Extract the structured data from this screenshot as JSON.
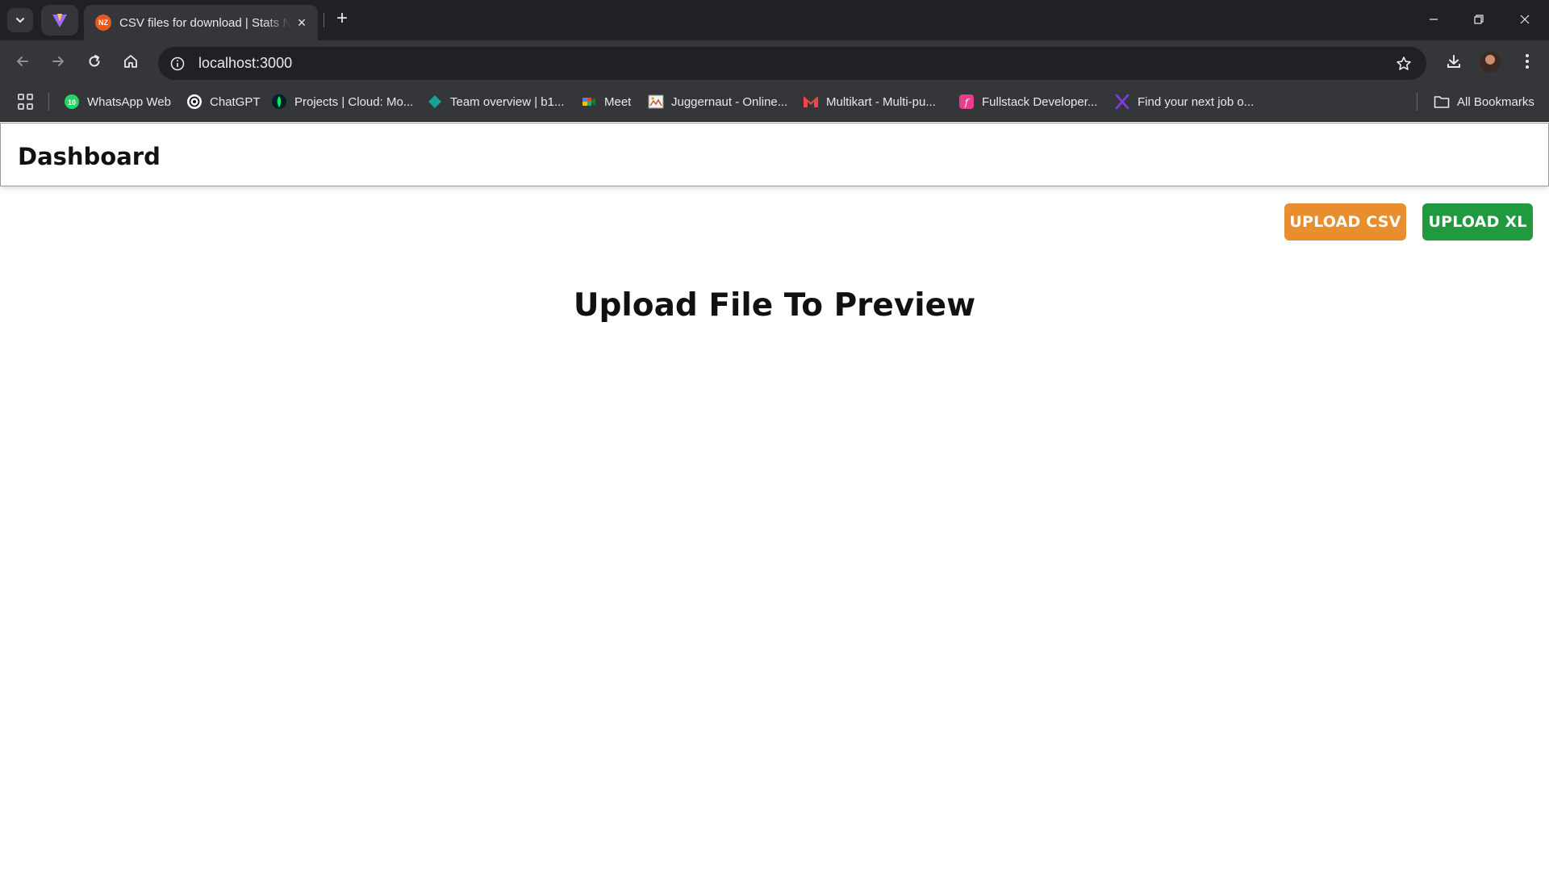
{
  "browser": {
    "active_tab_title": "CSV files for download | Stats NZ",
    "favicon_text": "NZ",
    "address": "localhost:3000",
    "bookmarks": [
      {
        "label": "WhatsApp Web",
        "icon": "whatsapp-icon"
      },
      {
        "label": "ChatGPT",
        "icon": "chatgpt-icon"
      },
      {
        "label": "Projects | Cloud: Mo...",
        "icon": "mongodb-icon"
      },
      {
        "label": "Team overview | b1...",
        "icon": "diamond-icon"
      },
      {
        "label": "Meet",
        "icon": "google-meet-icon"
      },
      {
        "label": "Juggernaut - Online...",
        "icon": "image-icon"
      },
      {
        "label": "Multikart - Multi-pu...",
        "icon": "multikart-icon"
      },
      {
        "label": "Fullstack Developer...",
        "icon": "fullstack-icon"
      },
      {
        "label": "Find your next job o...",
        "icon": "x-icon"
      }
    ],
    "all_bookmarks_label": "All Bookmarks"
  },
  "app": {
    "title": "Dashboard",
    "upload_csv_label": "UPLOAD CSV",
    "upload_xl_label": "UPLOAD XL",
    "preview_heading": "Upload File To Preview"
  },
  "colors": {
    "upload_csv": "#e98e2f",
    "upload_xl": "#219a3f",
    "browser_frame": "#202124",
    "browser_toolbar": "#35363a"
  }
}
